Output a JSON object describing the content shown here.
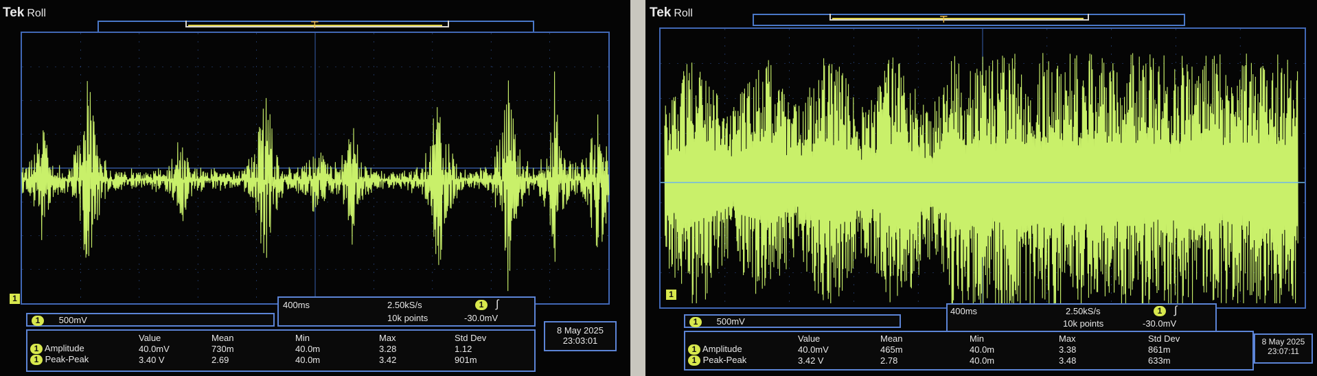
{
  "left": {
    "brand": "Tek",
    "mode": "Roll",
    "channel_label": "1",
    "scale": "500mV",
    "timebase": "400ms",
    "sample_rate": "2.50kS/s",
    "record_length": "10k points",
    "trigger_level": "-30.0mV",
    "trigger_slope_icon": "rising-edge-icon",
    "date": "8 May 2025",
    "time": "23:03:01",
    "measure_headers": [
      "Value",
      "Mean",
      "Min",
      "Max",
      "Std Dev"
    ],
    "measurements": [
      {
        "name": "Amplitude",
        "values": [
          "40.0mV",
          "730m",
          "40.0m",
          "3.28",
          "1.12"
        ]
      },
      {
        "name": "Peak-Peak",
        "values": [
          "3.40 V",
          "2.69",
          "40.0m",
          "3.42",
          "901m"
        ]
      }
    ]
  },
  "right": {
    "brand": "Tek",
    "mode": "Roll",
    "channel_label": "1",
    "scale": "500mV",
    "timebase": "400ms",
    "sample_rate": "2.50kS/s",
    "record_length": "10k points",
    "trigger_level": "-30.0mV",
    "trigger_slope_icon": "rising-edge-icon",
    "date": "8 May 2025",
    "time": "23:07:11",
    "measure_headers": [
      "Value",
      "Mean",
      "Min",
      "Max",
      "Std Dev"
    ],
    "measurements": [
      {
        "name": "Amplitude",
        "values": [
          "40.0mV",
          "465m",
          "40.0m",
          "3.38",
          "861m"
        ]
      },
      {
        "name": "Peak-Peak",
        "values": [
          "3.42 V",
          "2.78",
          "40.0m",
          "3.48",
          "633m"
        ]
      }
    ]
  },
  "colors": {
    "trace": "#c9f06a",
    "grid": "#3b63b5",
    "accent": "#d8e84d"
  }
}
